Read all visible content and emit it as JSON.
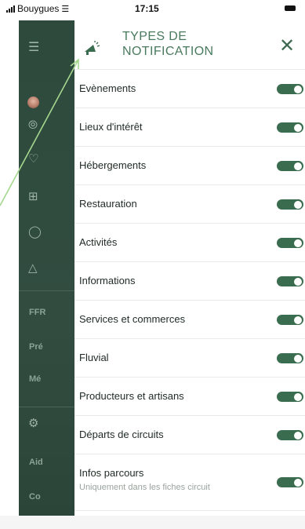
{
  "status_bar": {
    "carrier": "Bouygues",
    "time": "17:15"
  },
  "sidebar": {
    "labels": [
      "FFR",
      "Pré",
      "Mé",
      "Aid",
      "Co"
    ],
    "icons": [
      "menu-icon",
      "avatar",
      "compass-icon",
      "heart-icon",
      "plus-square-icon",
      "users-icon",
      "warning-icon",
      "gear-icon"
    ]
  },
  "header": {
    "title_line1": "TYPES DE",
    "title_line2": "NOTIFICATION",
    "close": "✕"
  },
  "items": [
    {
      "label": "Evènements",
      "enabled": true
    },
    {
      "label": "Lieux d'intérêt",
      "enabled": true
    },
    {
      "label": "Hébergements",
      "enabled": true
    },
    {
      "label": "Restauration",
      "enabled": true
    },
    {
      "label": "Activités",
      "enabled": true
    },
    {
      "label": "Informations",
      "enabled": true
    },
    {
      "label": "Services et commerces",
      "enabled": true
    },
    {
      "label": "Fluvial",
      "enabled": true
    },
    {
      "label": "Producteurs et artisans",
      "enabled": true
    },
    {
      "label": "Départs de circuits",
      "enabled": true
    },
    {
      "label": "Infos parcours",
      "sublabel": "Uniquement dans les fiches circuit",
      "enabled": true
    }
  ],
  "colors": {
    "accent": "#3a6c4f",
    "title": "#4a7a5e",
    "sidebar": "#2d4a3c",
    "annotation": "#a5d78e"
  }
}
